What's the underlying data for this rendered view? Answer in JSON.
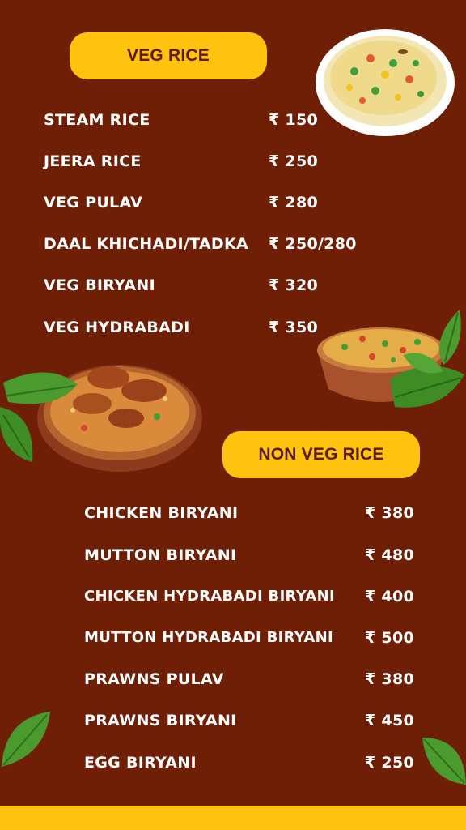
{
  "veg": {
    "title": "VEG RICE",
    "items": [
      {
        "name": "STEAM RICE",
        "price": "₹ 150"
      },
      {
        "name": "JEERA RICE",
        "price": "₹ 250"
      },
      {
        "name": "VEG PULAV",
        "price": "₹ 280"
      },
      {
        "name": "DAAL KHICHADI/TADKA",
        "price": "₹ 250/280"
      },
      {
        "name": "VEG BIRYANI",
        "price": "₹ 320"
      },
      {
        "name": "VEG HYDRABADI",
        "price": "₹ 350"
      }
    ]
  },
  "nonveg": {
    "title": "NON VEG RICE",
    "items": [
      {
        "name": "CHICKEN BIRYANI",
        "price": "₹ 380"
      },
      {
        "name": "MUTTON BIRYANI",
        "price": "₹ 480"
      },
      {
        "name": "CHICKEN HYDRABADI BIRYANI",
        "price": "₹ 400"
      },
      {
        "name": "MUTTON HYDRABADI BIRYANI",
        "price": "₹ 500"
      },
      {
        "name": "PRAWNS PULAV",
        "price": "₹ 380"
      },
      {
        "name": "PRAWNS BIRYANI",
        "price": "₹ 450"
      },
      {
        "name": "EGG BIRYANI",
        "price": "₹ 250"
      }
    ]
  },
  "colors": {
    "background": "#6e1f06",
    "accent": "#ffc20e",
    "text": "#ffffff"
  },
  "images": [
    "pulao-plate-image",
    "veg-biryani-bowl-image",
    "chicken-biryani-bowl-image",
    "basil-leaf-icon"
  ]
}
